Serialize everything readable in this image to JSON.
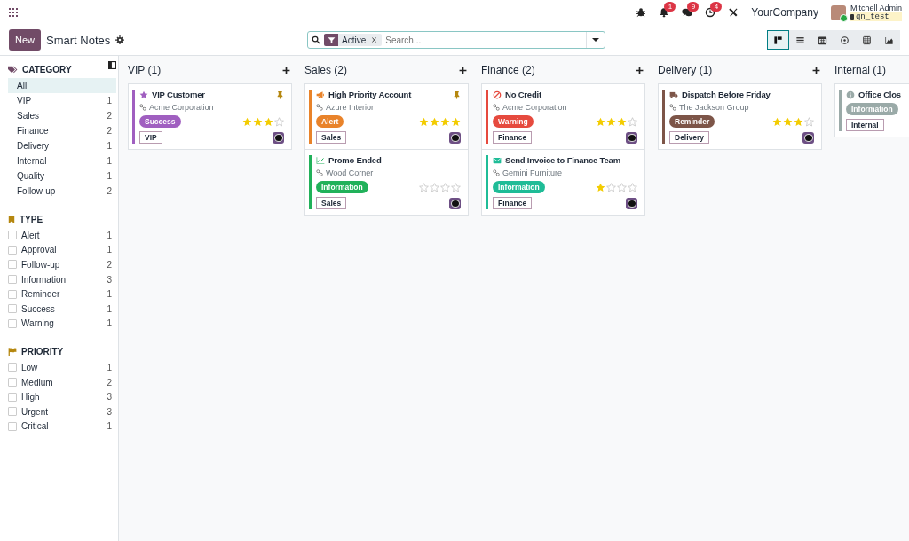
{
  "navbar": {
    "indicators": [
      {
        "kind": "bug"
      },
      {
        "kind": "bell",
        "count": "1"
      },
      {
        "kind": "chat",
        "count": "9"
      },
      {
        "kind": "clock",
        "count": "4"
      },
      {
        "kind": "tools"
      }
    ],
    "company": "YourCompany",
    "user": {
      "name": "Mitchell Admin",
      "database": "qn_test"
    }
  },
  "control_panel": {
    "new_button": "New",
    "title": "Smart Notes",
    "search": {
      "facet": "Active",
      "placeholder": "Search..."
    },
    "views": [
      {
        "kind": "kanban",
        "selected": true
      },
      {
        "kind": "list",
        "selected": false
      },
      {
        "kind": "calendar",
        "selected": false
      },
      {
        "kind": "activity",
        "selected": false
      },
      {
        "kind": "pivot",
        "selected": false
      },
      {
        "kind": "graph",
        "selected": false
      }
    ]
  },
  "sidebar": {
    "sections": [
      {
        "kind": "category",
        "title": "CATEGORY",
        "items": [
          {
            "label": "All",
            "selected": true
          },
          {
            "label": "VIP",
            "count": "1",
            "selected": false
          },
          {
            "label": "Sales",
            "count": "2",
            "selected": false
          },
          {
            "label": "Finance",
            "count": "2",
            "selected": false
          },
          {
            "label": "Delivery",
            "count": "1",
            "selected": false
          },
          {
            "label": "Internal",
            "count": "1",
            "selected": false
          },
          {
            "label": "Quality",
            "count": "1",
            "selected": false
          },
          {
            "label": "Follow-up",
            "count": "2",
            "selected": false
          }
        ]
      },
      {
        "kind": "type",
        "title": "TYPE",
        "items": [
          {
            "label": "Alert",
            "count": "1",
            "checked": false
          },
          {
            "label": "Approval",
            "count": "1",
            "checked": false
          },
          {
            "label": "Follow-up",
            "count": "2",
            "checked": false
          },
          {
            "label": "Information",
            "count": "3",
            "checked": false
          },
          {
            "label": "Reminder",
            "count": "1",
            "checked": false
          },
          {
            "label": "Success",
            "count": "1",
            "checked": false
          },
          {
            "label": "Warning",
            "count": "1",
            "checked": false
          }
        ]
      },
      {
        "kind": "priority",
        "title": "PRIORITY",
        "items": [
          {
            "label": "Low",
            "count": "1",
            "checked": false
          },
          {
            "label": "Medium",
            "count": "2",
            "checked": false
          },
          {
            "label": "High",
            "count": "3",
            "checked": false
          },
          {
            "label": "Urgent",
            "count": "3",
            "checked": false
          },
          {
            "label": "Critical",
            "count": "1",
            "checked": false
          }
        ]
      }
    ]
  },
  "kanban": {
    "columns": [
      {
        "title": "VIP (1)",
        "cards": [
          {
            "kind": "star",
            "title": "VIP Customer",
            "company": "Acme Corporation",
            "badge": "Success",
            "color": "#a05fc0",
            "stars": 3,
            "tag": "VIP",
            "pinned": true
          }
        ]
      },
      {
        "title": "Sales (2)",
        "cards": [
          {
            "kind": "megaphone",
            "title": "High Priority Account",
            "company": "Azure Interior",
            "badge": "Alert",
            "color": "#e9832a",
            "stars": 4,
            "tag": "Sales",
            "pinned": true
          },
          {
            "kind": "chart",
            "title": "Promo Ended",
            "company": "Wood Corner",
            "badge": "Information",
            "color": "#21b15a",
            "stars": 0,
            "tag": "Sales",
            "pinned": false
          }
        ]
      },
      {
        "title": "Finance (2)",
        "cards": [
          {
            "kind": "ban",
            "title": "No Credit",
            "company": "Acme Corporation",
            "badge": "Warning",
            "color": "#e64a3e",
            "stars": 3,
            "tag": "Finance",
            "pinned": false
          },
          {
            "kind": "envelope",
            "title": "Send Invoice to Finance Team",
            "company": "Gemini Furniture",
            "badge": "Information",
            "color": "#1fbc97",
            "stars": 1,
            "tag": "Finance",
            "pinned": false
          }
        ]
      },
      {
        "title": "Delivery (1)",
        "cards": [
          {
            "kind": "truck",
            "title": "Dispatch Before Friday",
            "company": "The Jackson Group",
            "badge": "Reminder",
            "color": "#7d5548",
            "stars": 3,
            "tag": "Delivery",
            "pinned": false
          }
        ]
      },
      {
        "title": "Internal (1)",
        "cards": [
          {
            "kind": "info",
            "title": "Office Clos",
            "badge": "Information",
            "color": "#9aaaa8",
            "tag": "Internal"
          }
        ]
      }
    ]
  }
}
